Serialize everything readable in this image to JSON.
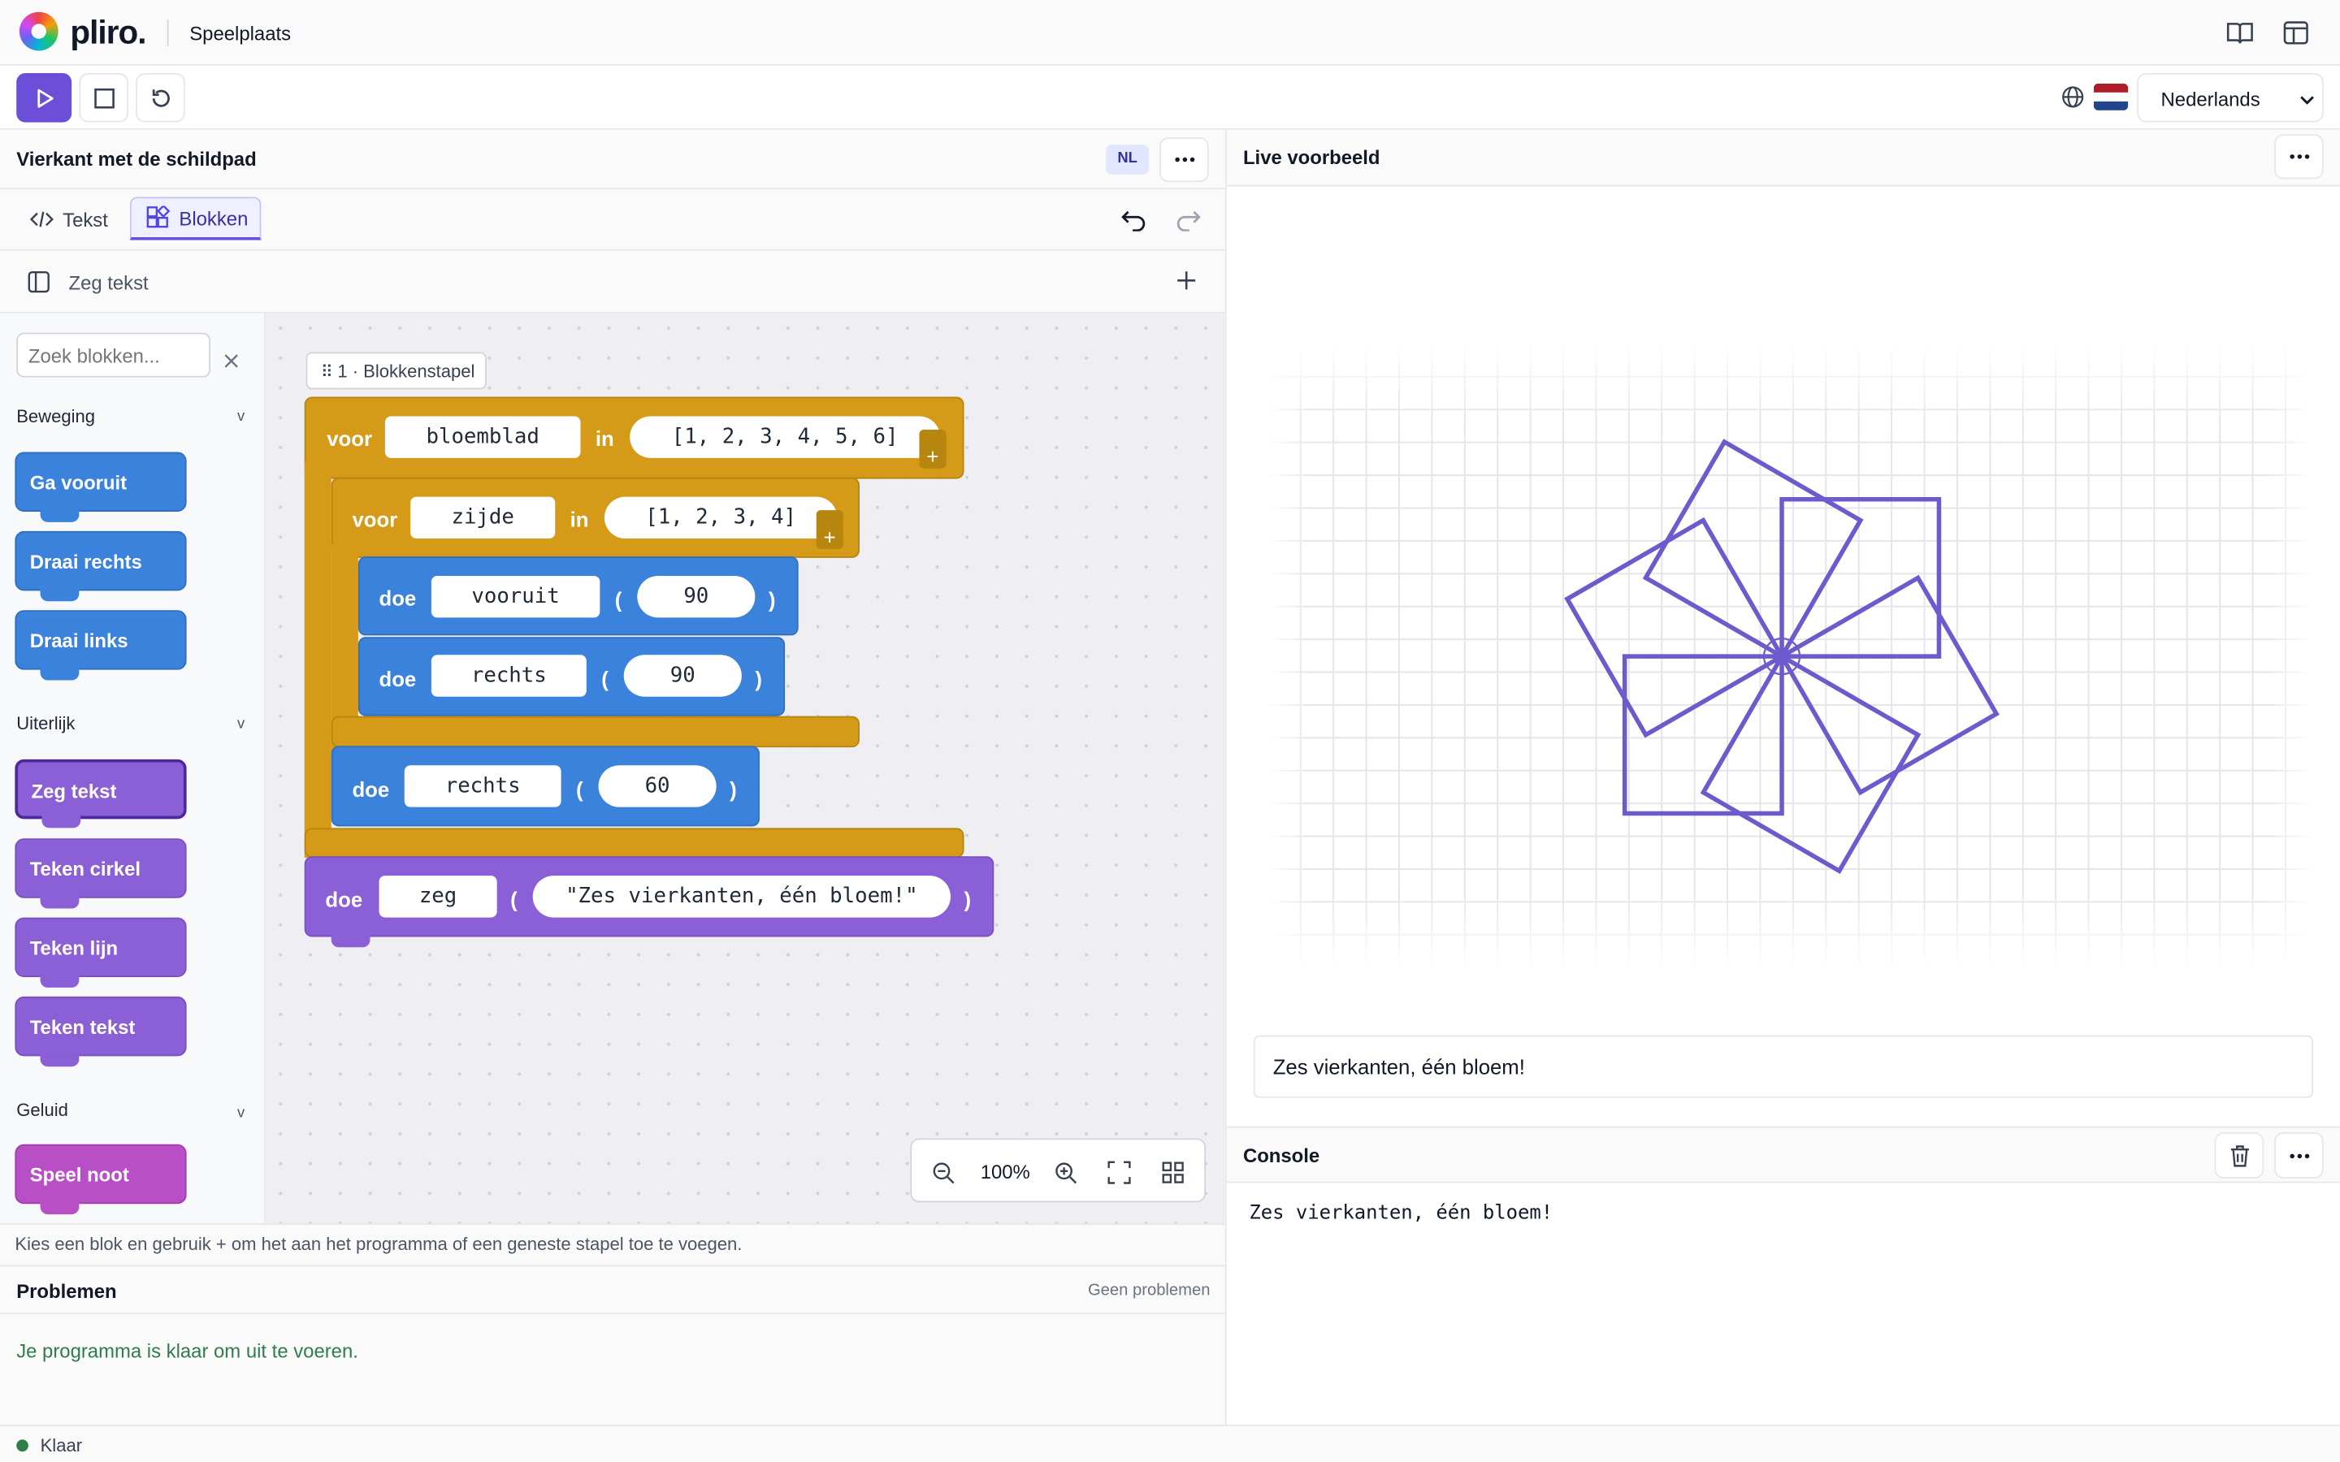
{
  "app": {
    "brand": "pliro.",
    "page": "Speelplaats"
  },
  "toolbar": {
    "language_flag": "NL flag",
    "language": "Nederlands"
  },
  "editor": {
    "title": "Vierkant met de schildpad",
    "lang_badge": "NL",
    "tabs": [
      {
        "label": "Tekst"
      },
      {
        "label": "Blokken"
      }
    ],
    "block_bar_label": "Zeg tekst",
    "search_placeholder": "Zoek blokken...",
    "zoom": "100%",
    "hint": "Kies een blok en gebruik + om het aan het programma of een geneste stapel toe te voegen."
  },
  "palette": {
    "categories": [
      {
        "name": "Beweging",
        "blocks": [
          "Ga vooruit",
          "Draai rechts",
          "Draai links"
        ]
      },
      {
        "name": "Uiterlijk",
        "blocks": [
          "Zeg tekst",
          "Teken cirkel",
          "Teken lijn",
          "Teken tekst"
        ]
      },
      {
        "name": "Geluid",
        "blocks": [
          "Speel noot"
        ]
      }
    ]
  },
  "workspace": {
    "stack_label": "1 · Blokkenstapel",
    "outer_loop": {
      "keyword": "voor",
      "var": "bloemblad",
      "in": "in",
      "list": "[1, 2, 3, 4, 5, 6]"
    },
    "inner_loop": {
      "keyword": "voor",
      "var": "zijde",
      "in": "in",
      "list": "[1, 2, 3, 4]"
    },
    "steps": [
      {
        "keyword": "doe",
        "fn": "vooruit",
        "arg": "90"
      },
      {
        "keyword": "doe",
        "fn": "rechts",
        "arg": "90"
      },
      {
        "keyword": "doe",
        "fn": "rechts",
        "arg": "60"
      }
    ],
    "say": {
      "keyword": "doe",
      "fn": "zeg",
      "arg": "\"Zes vierkanten, één bloem!\""
    }
  },
  "problems": {
    "title": "Problemen",
    "count": "Geen problemen",
    "message": "Je programma is klaar om uit te voeren."
  },
  "preview": {
    "title": "Live voorbeeld",
    "speech": "Zes vierkanten, één bloem!",
    "drawing": {
      "squares": 6,
      "side": 90,
      "turn_per_square": 60,
      "color": "#6d5acd"
    }
  },
  "console": {
    "title": "Console",
    "output": "Zes vierkanten, één bloem!"
  },
  "status": {
    "text": "Klaar"
  },
  "colors": {
    "accent": "#6b4fd8",
    "control": "#d49a18",
    "motion": "#3b82dd",
    "looks": "#8b5fd6",
    "sound": "#b84fc6",
    "ok": "#2f7d4a"
  }
}
